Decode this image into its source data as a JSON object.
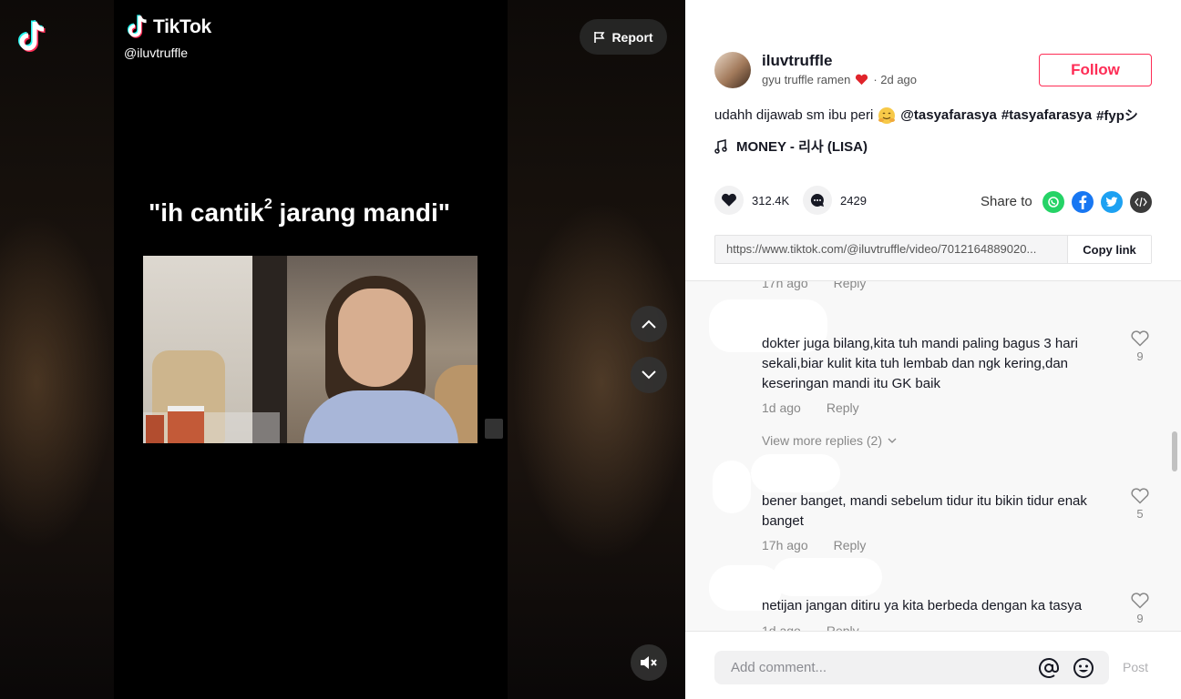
{
  "video": {
    "brand": "TikTok",
    "username": "@iluvtruffle",
    "report_label": "Report",
    "caption_main": "\"ih cantik",
    "caption_sup": "2",
    "caption_end": " jarang mandi\""
  },
  "post": {
    "author": "iluvtruffle",
    "nickname": "gyu truffle ramen",
    "time": "· 2d ago",
    "follow_label": "Follow",
    "description_text": "udahh dijawab sm ibu peri",
    "description_tags": [
      "@tasyafarasya",
      "#tasyafarasya",
      "#fypシ"
    ],
    "music": "MONEY - 리사 (LISA)",
    "likes": "312.4K",
    "comments_count": "2429",
    "share_label": "Share to",
    "share_targets": [
      "whatsapp-icon",
      "facebook-icon",
      "twitter-icon",
      "embed-icon"
    ],
    "link": "https://www.tiktok.com/@iluvtruffle/video/7012164889020...",
    "copy_label": "Copy link"
  },
  "comments": {
    "partial_top": {
      "time": "17h ago",
      "reply": "Reply"
    },
    "items": [
      {
        "text": "dokter juga bilang,kita tuh mandi paling bagus 3 hari sekali,biar kulit kita tuh lembab dan ngk kering,dan keseringan mandi itu GK baik",
        "time": "1d ago",
        "reply": "Reply",
        "likes": "9"
      },
      {
        "text": "bener banget, mandi sebelum tidur itu bikin tidur enak banget",
        "time": "17h ago",
        "reply": "Reply",
        "likes": "5"
      },
      {
        "text": "netijan jangan ditiru ya kita berbeda dengan ka tasya",
        "time": "1d ago",
        "reply": "Reply",
        "likes": "9"
      }
    ],
    "view_more": "View more replies (2)"
  },
  "footer": {
    "placeholder": "Add comment...",
    "post_label": "Post"
  },
  "colors": {
    "accent": "#fe2c55",
    "whatsapp": "#25d366",
    "facebook": "#1877f2",
    "twitter": "#1da1f2",
    "embed": "#3a3a3a"
  }
}
